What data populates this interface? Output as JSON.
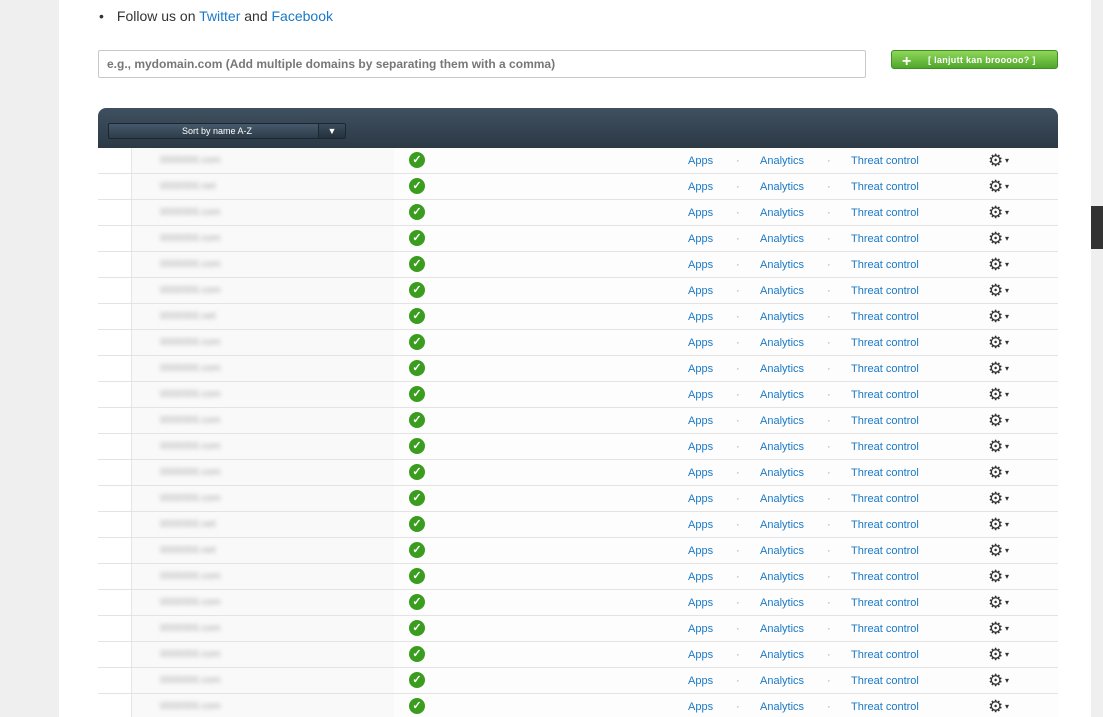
{
  "follow": {
    "bullet": "•",
    "prefix": "Follow us on",
    "twitter": "Twitter",
    "and": "and",
    "facebook": "Facebook"
  },
  "add_domain": {
    "placeholder": "e.g., mydomain.com (Add multiple domains by separating them with a comma)",
    "button_label": "[ lanjutt kan brooooo? ]",
    "button_icon": "plus-icon"
  },
  "table": {
    "sort_label": "Sort by name A-Z",
    "sort_arrow": "▼",
    "link_labels": {
      "apps": "Apps",
      "analytics": "Analytics",
      "threat": "Threat control"
    },
    "separator": "·",
    "status_glyph": "✓",
    "gear_glyph": "⚙",
    "caret_glyph": "▾",
    "rows": [
      "0000000.com",
      "0000000.net",
      "0000000.com",
      "0000000.com",
      "0000000.com",
      "0000000.com",
      "0000000.net",
      "0000000.com",
      "0000000.com",
      "0000000.com",
      "0000000.com",
      "0000000.com",
      "0000000.com",
      "0000000.com",
      "0000000.net",
      "0000000.net",
      "0000000.com",
      "0000000.com",
      "0000000.com",
      "0000000.com",
      "0000000.com",
      "0000000.com"
    ]
  },
  "colors": {
    "link": "#1a79c6",
    "header": "#2c3945",
    "check": "#3b9d1f",
    "button": "#5cb531"
  }
}
